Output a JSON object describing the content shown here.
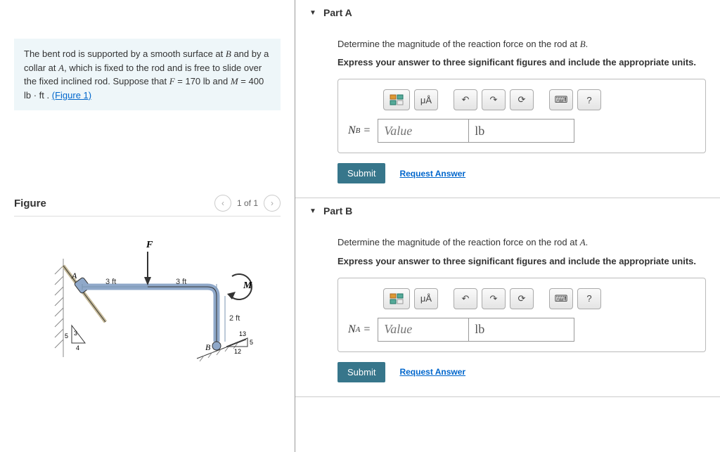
{
  "problem": {
    "text_1": "The bent rod is supported by a smooth surface at ",
    "point_B": "B",
    "text_2": " and by a collar at ",
    "point_A": "A",
    "text_3": ", which is fixed to the rod and is free to slide over the fixed inclined rod. Suppose that ",
    "F_label": "F",
    "F_value": " = 170  lb",
    "and": " and ",
    "M_label": "M",
    "M_value": " = 400  lb · ft",
    "period": " . ",
    "figure_link": "(Figure 1)"
  },
  "figure": {
    "title": "Figure",
    "nav_text": "1 of 1",
    "labels": {
      "F": "F",
      "M": "M",
      "A": "A",
      "B": "B",
      "d1": "3 ft",
      "d2": "3 ft",
      "d3": "2 ft",
      "tri_a": "3",
      "tri_a2": "4",
      "tri_a3": "5",
      "tri_b": "13",
      "tri_b2": "12",
      "tri_b3": "5"
    }
  },
  "partA": {
    "title": "Part A",
    "instruction_1": "Determine the magnitude of the reaction force on the rod at ",
    "point": "B",
    "instruction_2": "Express your answer to three significant figures and include the appropriate units.",
    "var": "N",
    "sub": "B",
    "placeholder": "Value",
    "unit": "lb",
    "submit": "Submit",
    "request": "Request Answer"
  },
  "partB": {
    "title": "Part B",
    "instruction_1": "Determine the magnitude of the reaction force on the rod at ",
    "point": "A",
    "instruction_2": "Express your answer to three significant figures and include the appropriate units.",
    "var": "N",
    "sub": "A",
    "placeholder": "Value",
    "unit": "lb",
    "submit": "Submit",
    "request": "Request Answer"
  },
  "tools": {
    "templates": "⊞",
    "micro": "μÅ",
    "undo": "↶",
    "redo": "↷",
    "reset": "⟳",
    "keyboard": "⌨",
    "help": "?"
  }
}
